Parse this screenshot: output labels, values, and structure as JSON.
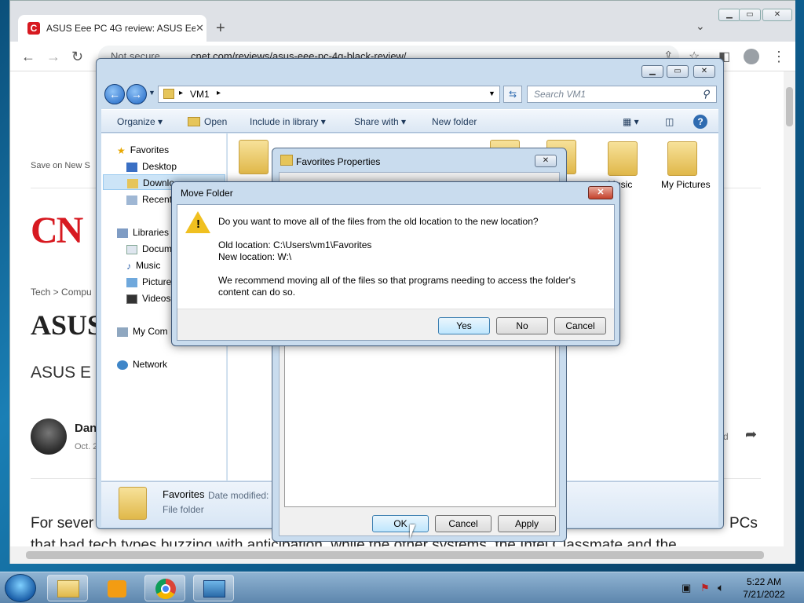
{
  "browser": {
    "tab_title": "ASUS Eee PC 4G review: ASUS Ee",
    "not_secure": "Not secure",
    "url": "cnet.com/reviews/asus-eee-pc-4g-black-review/"
  },
  "page": {
    "save_on": "Save on New S",
    "logo": "CN",
    "breadcrumb": "Tech  >  Compu",
    "headline": "ASUS",
    "subtitle": "ASUS E",
    "author": "Dan",
    "date": "Oct. 2",
    "partial_right": "d",
    "body_line1": "For sever",
    "body_line1_right": "PCs",
    "body_line2": "that had tech types buzzing with anticipation, while the other systems, the Intel Classmate and the"
  },
  "explorer": {
    "breadcrumb": "VM1",
    "search_placeholder": "Search VM1",
    "cmd": {
      "organize": "Organize",
      "open": "Open",
      "include": "Include in library",
      "share": "Share with",
      "new_folder": "New folder"
    },
    "nav": {
      "favorites": "Favorites",
      "desktop": "Desktop",
      "downloads": "Downlo",
      "recent": "Recent",
      "libraries": "Libraries",
      "documents": "Docum",
      "music": "Music",
      "pictures": "Picture",
      "videos": "Videos",
      "computer": "My Com",
      "network": "Network"
    },
    "folders": {
      "music": "Music",
      "pictures": "My Pictures"
    },
    "details": {
      "name": "Favorites",
      "date_label": "Date modified:",
      "type": "File folder"
    }
  },
  "props": {
    "title": "Favorites Properties",
    "ok": "OK",
    "cancel": "Cancel",
    "apply": "Apply"
  },
  "move": {
    "title": "Move Folder",
    "question": "Do you want to move all of the files from the old location to the new location?",
    "old_location": "Old location: C:\\Users\\vm1\\Favorites",
    "new_location": "New location: W:\\",
    "recommend_1": "We recommend moving all of the files so that programs needing to access the folder's",
    "recommend_2": "content can do so.",
    "yes": "Yes",
    "no": "No",
    "cancel": "Cancel"
  },
  "taskbar": {
    "time": "5:22 AM",
    "date": "7/21/2022"
  }
}
